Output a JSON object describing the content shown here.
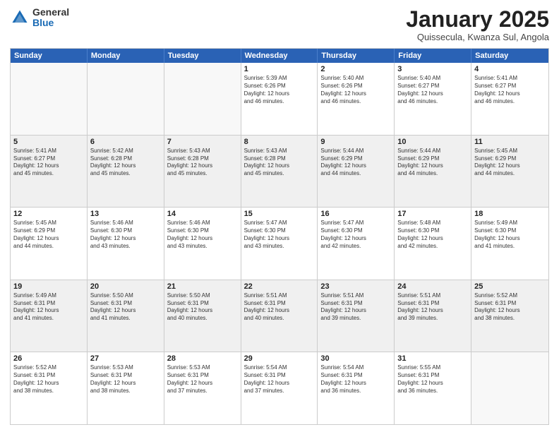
{
  "logo": {
    "general": "General",
    "blue": "Blue"
  },
  "header": {
    "month": "January 2025",
    "location": "Quissecula, Kwanza Sul, Angola"
  },
  "days": [
    "Sunday",
    "Monday",
    "Tuesday",
    "Wednesday",
    "Thursday",
    "Friday",
    "Saturday"
  ],
  "weeks": [
    [
      {
        "num": "",
        "text": "",
        "empty": true
      },
      {
        "num": "",
        "text": "",
        "empty": true
      },
      {
        "num": "",
        "text": "",
        "empty": true
      },
      {
        "num": "1",
        "text": "Sunrise: 5:39 AM\nSunset: 6:26 PM\nDaylight: 12 hours\nand 46 minutes."
      },
      {
        "num": "2",
        "text": "Sunrise: 5:40 AM\nSunset: 6:26 PM\nDaylight: 12 hours\nand 46 minutes."
      },
      {
        "num": "3",
        "text": "Sunrise: 5:40 AM\nSunset: 6:27 PM\nDaylight: 12 hours\nand 46 minutes."
      },
      {
        "num": "4",
        "text": "Sunrise: 5:41 AM\nSunset: 6:27 PM\nDaylight: 12 hours\nand 46 minutes."
      }
    ],
    [
      {
        "num": "5",
        "text": "Sunrise: 5:41 AM\nSunset: 6:27 PM\nDaylight: 12 hours\nand 45 minutes.",
        "shaded": true
      },
      {
        "num": "6",
        "text": "Sunrise: 5:42 AM\nSunset: 6:28 PM\nDaylight: 12 hours\nand 45 minutes.",
        "shaded": true
      },
      {
        "num": "7",
        "text": "Sunrise: 5:43 AM\nSunset: 6:28 PM\nDaylight: 12 hours\nand 45 minutes.",
        "shaded": true
      },
      {
        "num": "8",
        "text": "Sunrise: 5:43 AM\nSunset: 6:28 PM\nDaylight: 12 hours\nand 45 minutes.",
        "shaded": true
      },
      {
        "num": "9",
        "text": "Sunrise: 5:44 AM\nSunset: 6:29 PM\nDaylight: 12 hours\nand 44 minutes.",
        "shaded": true
      },
      {
        "num": "10",
        "text": "Sunrise: 5:44 AM\nSunset: 6:29 PM\nDaylight: 12 hours\nand 44 minutes.",
        "shaded": true
      },
      {
        "num": "11",
        "text": "Sunrise: 5:45 AM\nSunset: 6:29 PM\nDaylight: 12 hours\nand 44 minutes.",
        "shaded": true
      }
    ],
    [
      {
        "num": "12",
        "text": "Sunrise: 5:45 AM\nSunset: 6:29 PM\nDaylight: 12 hours\nand 44 minutes."
      },
      {
        "num": "13",
        "text": "Sunrise: 5:46 AM\nSunset: 6:30 PM\nDaylight: 12 hours\nand 43 minutes."
      },
      {
        "num": "14",
        "text": "Sunrise: 5:46 AM\nSunset: 6:30 PM\nDaylight: 12 hours\nand 43 minutes."
      },
      {
        "num": "15",
        "text": "Sunrise: 5:47 AM\nSunset: 6:30 PM\nDaylight: 12 hours\nand 43 minutes."
      },
      {
        "num": "16",
        "text": "Sunrise: 5:47 AM\nSunset: 6:30 PM\nDaylight: 12 hours\nand 42 minutes."
      },
      {
        "num": "17",
        "text": "Sunrise: 5:48 AM\nSunset: 6:30 PM\nDaylight: 12 hours\nand 42 minutes."
      },
      {
        "num": "18",
        "text": "Sunrise: 5:49 AM\nSunset: 6:30 PM\nDaylight: 12 hours\nand 41 minutes."
      }
    ],
    [
      {
        "num": "19",
        "text": "Sunrise: 5:49 AM\nSunset: 6:31 PM\nDaylight: 12 hours\nand 41 minutes.",
        "shaded": true
      },
      {
        "num": "20",
        "text": "Sunrise: 5:50 AM\nSunset: 6:31 PM\nDaylight: 12 hours\nand 41 minutes.",
        "shaded": true
      },
      {
        "num": "21",
        "text": "Sunrise: 5:50 AM\nSunset: 6:31 PM\nDaylight: 12 hours\nand 40 minutes.",
        "shaded": true
      },
      {
        "num": "22",
        "text": "Sunrise: 5:51 AM\nSunset: 6:31 PM\nDaylight: 12 hours\nand 40 minutes.",
        "shaded": true
      },
      {
        "num": "23",
        "text": "Sunrise: 5:51 AM\nSunset: 6:31 PM\nDaylight: 12 hours\nand 39 minutes.",
        "shaded": true
      },
      {
        "num": "24",
        "text": "Sunrise: 5:51 AM\nSunset: 6:31 PM\nDaylight: 12 hours\nand 39 minutes.",
        "shaded": true
      },
      {
        "num": "25",
        "text": "Sunrise: 5:52 AM\nSunset: 6:31 PM\nDaylight: 12 hours\nand 38 minutes.",
        "shaded": true
      }
    ],
    [
      {
        "num": "26",
        "text": "Sunrise: 5:52 AM\nSunset: 6:31 PM\nDaylight: 12 hours\nand 38 minutes."
      },
      {
        "num": "27",
        "text": "Sunrise: 5:53 AM\nSunset: 6:31 PM\nDaylight: 12 hours\nand 38 minutes."
      },
      {
        "num": "28",
        "text": "Sunrise: 5:53 AM\nSunset: 6:31 PM\nDaylight: 12 hours\nand 37 minutes."
      },
      {
        "num": "29",
        "text": "Sunrise: 5:54 AM\nSunset: 6:31 PM\nDaylight: 12 hours\nand 37 minutes."
      },
      {
        "num": "30",
        "text": "Sunrise: 5:54 AM\nSunset: 6:31 PM\nDaylight: 12 hours\nand 36 minutes."
      },
      {
        "num": "31",
        "text": "Sunrise: 5:55 AM\nSunset: 6:31 PM\nDaylight: 12 hours\nand 36 minutes."
      },
      {
        "num": "",
        "text": "",
        "empty": true
      }
    ]
  ]
}
